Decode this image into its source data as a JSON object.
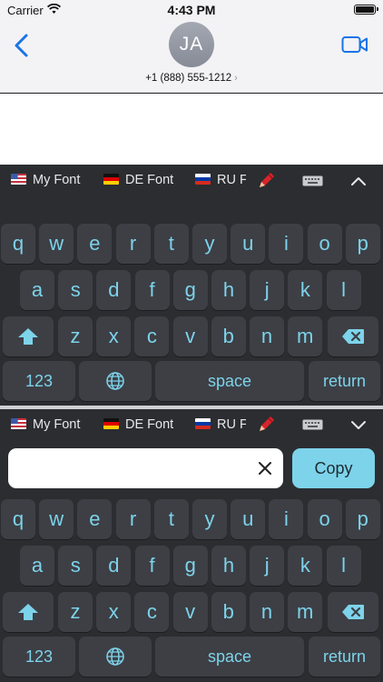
{
  "status_bar": {
    "carrier": "Carrier",
    "time": "4:43 PM"
  },
  "contact": {
    "initials": "JA",
    "phone": "+1 (888) 555-1212",
    "phone_chevron": "›"
  },
  "toolbar": {
    "items": [
      {
        "flag": "us-flag",
        "label": "My Font"
      },
      {
        "flag": "de-flag",
        "label": "DE Font"
      },
      {
        "flag": "ru-flag",
        "label": "RU Font"
      }
    ],
    "icons": [
      "pen-icon",
      "keyboard-icon"
    ],
    "collapse_icon_top": "chevron-up-icon",
    "collapse_icon_bottom": "chevron-down-icon"
  },
  "keyboard": {
    "row1": [
      "q",
      "w",
      "e",
      "r",
      "t",
      "y",
      "u",
      "i",
      "o",
      "p"
    ],
    "row2": [
      "a",
      "s",
      "d",
      "f",
      "g",
      "h",
      "j",
      "k",
      "l"
    ],
    "row3": [
      "z",
      "x",
      "c",
      "v",
      "b",
      "n",
      "m"
    ],
    "numbers_label": "123",
    "space_label": "space",
    "return_label": "return"
  },
  "copy_panel": {
    "input_value": "",
    "input_placeholder": "",
    "copy_label": "Copy"
  },
  "colors": {
    "accent": "#7dd3ea",
    "key_bg": "#3d3f45",
    "keyboard_bg": "#2b2d31",
    "ios_blue": "#1a73e8"
  }
}
